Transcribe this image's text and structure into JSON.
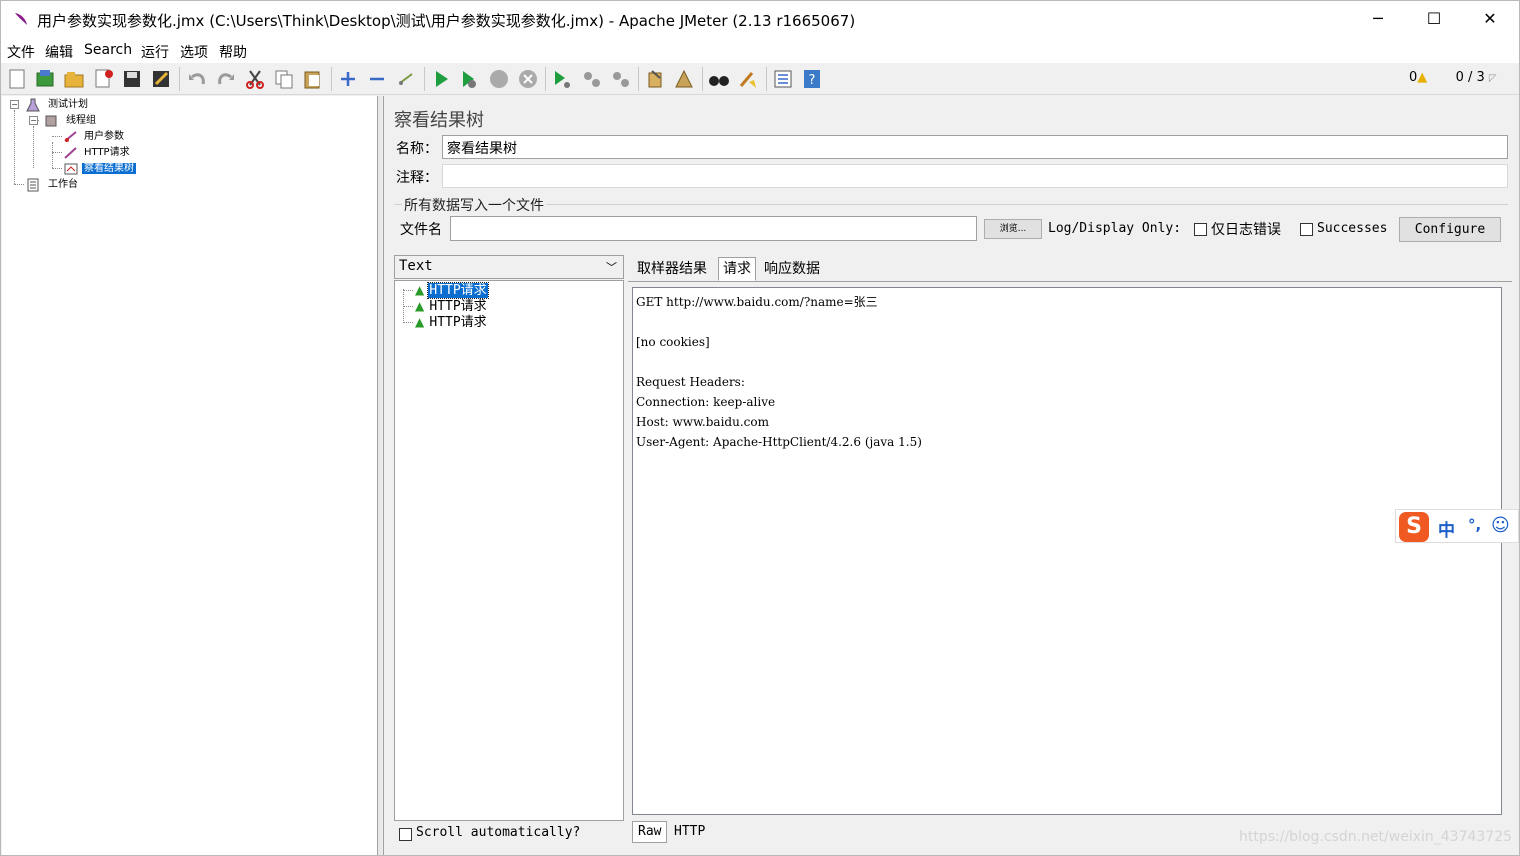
{
  "window": {
    "title": "用户参数实现参数化.jmx (C:\\Users\\Think\\Desktop\\测试\\用户参数实现参数化.jmx) - Apache JMeter (2.13 r1665067)",
    "minimize": "─",
    "maximize": "☐",
    "close": "✕"
  },
  "menu": [
    "文件",
    "编辑",
    "Search",
    "运行",
    "选项",
    "帮助"
  ],
  "toolbar": {
    "warning_count": "0",
    "thread_status": "0 / 3"
  },
  "tree": {
    "test_plan": "测试计划",
    "thread_group": "线程组",
    "user_params": "用户参数",
    "http_request": "HTTP请求",
    "view_results_tree": "察看结果树",
    "workbench": "工作台"
  },
  "panel": {
    "title": "察看结果树",
    "name_label": "名称：",
    "name_value": "察看结果树",
    "comment_label": "注释：",
    "comment_value": "",
    "file_group_title": "所有数据写入一个文件",
    "filename_label": "文件名",
    "filename_value": "",
    "browse_button": "浏览...",
    "log_display_only": "Log/Display Only:",
    "errors_only_label": "仅日志错误",
    "successes_label": "Successes",
    "configure_button": "Configure"
  },
  "results": {
    "renderer": "Text",
    "samples": [
      "HTTP请求",
      "HTTP请求",
      "HTTP请求"
    ],
    "scroll_auto": "Scroll automatically?"
  },
  "detail": {
    "tabs": [
      "取样器结果",
      "请求",
      "响应数据"
    ],
    "active_tab": "请求",
    "lines": [
      "GET http://www.baidu.com/?name=张三",
      "",
      "[no cookies]",
      "",
      "Request Headers:",
      "Connection: keep-alive",
      "Host: www.baidu.com",
      "User-Agent: Apache-HttpClient/4.2.6 (java 1.5)"
    ],
    "bottom_tabs": [
      "Raw",
      "HTTP"
    ]
  },
  "ime": {
    "mode": "中",
    "punct": "°,"
  },
  "watermark": "https://blog.csdn.net/weixin_43743725"
}
